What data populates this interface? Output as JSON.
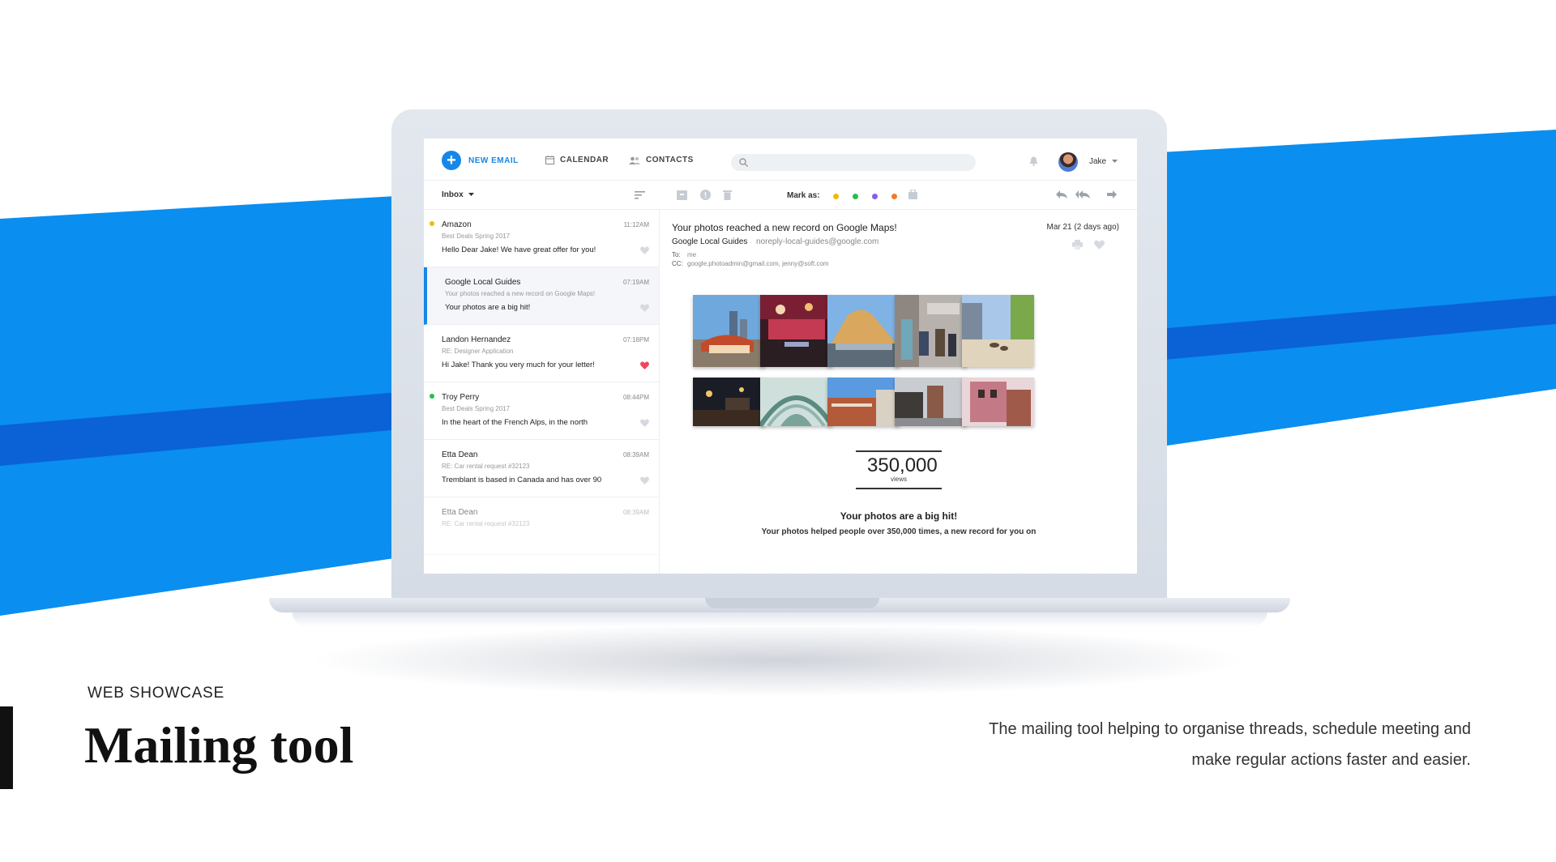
{
  "colors": {
    "accent": "#1687e8",
    "stripe_light": "#0a8ef0",
    "stripe_dark": "#0a62d6",
    "heart_active": "#f0455b"
  },
  "app": {
    "new_email_label": "NEW EMAIL",
    "nav": {
      "calendar": "CALENDAR",
      "contacts": "CONTACTS"
    },
    "search_placeholder": "",
    "user_name": "Jake"
  },
  "toolbar": {
    "folder": "Inbox",
    "mark_as_label": "Mark as:",
    "mark_colors": [
      "#f5b800",
      "#1fc24a",
      "#8a5cf0",
      "#f27a2c"
    ]
  },
  "emails": [
    {
      "sender": "Amazon",
      "time": "11:12AM",
      "subject": "Best Deals Spring 2017",
      "preview": "Hello Dear Jake! We have great offer for you!",
      "unread_color": "#f5b800",
      "liked": false,
      "selected": false
    },
    {
      "sender": "Google Local Guides",
      "time": "07:19AM",
      "subject": "Your photos reached a new record on Google Maps!",
      "preview": "Your photos are a big hit!",
      "unread_color": "",
      "liked": false,
      "selected": true
    },
    {
      "sender": "Landon Hernandez",
      "time": "07:18PM",
      "subject": "RE: Designer Application",
      "preview": "Hi Jake! Thank you very much for your letter!",
      "unread_color": "",
      "liked": true,
      "selected": false
    },
    {
      "sender": "Troy Perry",
      "time": "08:44PM",
      "subject": "Best Deals Spring 2017",
      "preview": "In the heart of the French Alps, in the north",
      "unread_color": "#1fc24a",
      "liked": false,
      "selected": false
    },
    {
      "sender": "Etta Dean",
      "time": "08:39AM",
      "subject": "RE: Car rental request #32123",
      "preview": "Tremblant is based in Canada and has over 90",
      "unread_color": "",
      "liked": false,
      "selected": false
    },
    {
      "sender": "Etta Dean",
      "time": "08:39AM",
      "subject": "RE: Car rental request #32123",
      "preview": "",
      "unread_color": "",
      "liked": false,
      "selected": false
    }
  ],
  "message": {
    "subject": "Your photos reached a new record on Google Maps!",
    "date": "Mar 21 (2 days ago)",
    "from_name": "Google Local Guides",
    "from_email": "noreply-local-guides@google.com",
    "to_label": "To:",
    "to": "me",
    "cc_label": "CC:",
    "cc": "google.photoadmin@gmail.com, jenny@soft.com",
    "views_number": "350,000",
    "views_unit": "views",
    "headline": "Your photos are a big hit!",
    "body": "Your photos helped people over 350,000 times, a new record for you on"
  },
  "caption": {
    "kicker": "WEB SHOWCASE",
    "title": "Mailing tool",
    "description_line1": "The mailing tool helping to organise threads, schedule meeting and",
    "description_line2": "make regular actions faster and easier."
  }
}
